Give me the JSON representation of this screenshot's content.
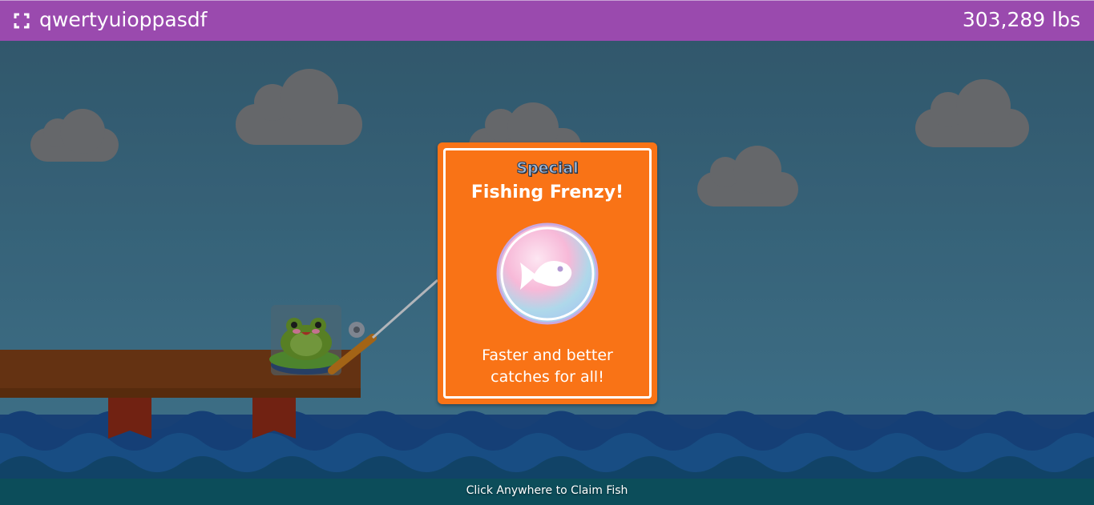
{
  "header": {
    "fullscreen_icon": "fullscreen-icon",
    "username": "qwertyuioppasdf",
    "weight": "303,289 lbs",
    "background_color": "#9a4aae"
  },
  "event_card": {
    "badge": "Special",
    "title": "Fishing Frenzy!",
    "icon": "fish-icon",
    "description_line1": "Faster and better",
    "description_line2": "catches for all!",
    "background_color": "#f97316"
  },
  "scene": {
    "character": "frog-icon",
    "prop": "fishing-rod-icon"
  },
  "footer": {
    "instruction": "Click Anywhere to Claim Fish"
  }
}
